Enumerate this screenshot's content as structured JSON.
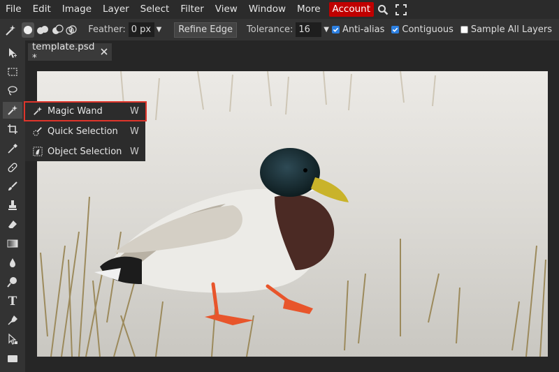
{
  "menubar": {
    "items": [
      "File",
      "Edit",
      "Image",
      "Layer",
      "Select",
      "Filter",
      "View",
      "Window",
      "More"
    ],
    "account_label": "Account",
    "icons": [
      "search-icon",
      "fullscreen-icon"
    ]
  },
  "options": {
    "mode_icons": [
      "new-selection-icon",
      "add-selection-icon",
      "subtract-selection-icon",
      "intersect-selection-icon"
    ],
    "feather_label": "Feather:",
    "feather_value": "0 px",
    "refine_edge_label": "Refine Edge",
    "tolerance_label": "Tolerance:",
    "tolerance_value": "16",
    "anti_alias_label": "Anti-alias",
    "anti_alias_checked": true,
    "contiguous_label": "Contiguous",
    "contiguous_checked": true,
    "sample_all_label": "Sample All Layers",
    "sample_all_checked": false
  },
  "tab": {
    "title": "template.psd *"
  },
  "toolbar": {
    "tools": [
      "move-tool",
      "marquee-tool",
      "lasso-tool",
      "magic-wand-tool",
      "crop-tool",
      "eyedropper-tool",
      "healing-tool",
      "brush-tool",
      "stamp-tool",
      "eraser-tool",
      "gradient-tool",
      "blur-tool",
      "dodge-tool",
      "type-tool",
      "pen-tool",
      "path-select-tool",
      "shape-tool"
    ],
    "active": "magic-wand-tool",
    "type_tool_glyph": "T"
  },
  "flyout": {
    "items": [
      {
        "label": "Magic Wand",
        "shortcut": "W",
        "icon": "magic-wand-icon"
      },
      {
        "label": "Quick Selection",
        "shortcut": "W",
        "icon": "quick-selection-icon"
      },
      {
        "label": "Object Selection",
        "shortcut": "W",
        "icon": "object-selection-icon"
      }
    ],
    "highlighted": "Magic Wand"
  },
  "colors": {
    "accent": "#c00000",
    "highlight": "#e0352b",
    "checkbox": "#2c7fe0"
  }
}
